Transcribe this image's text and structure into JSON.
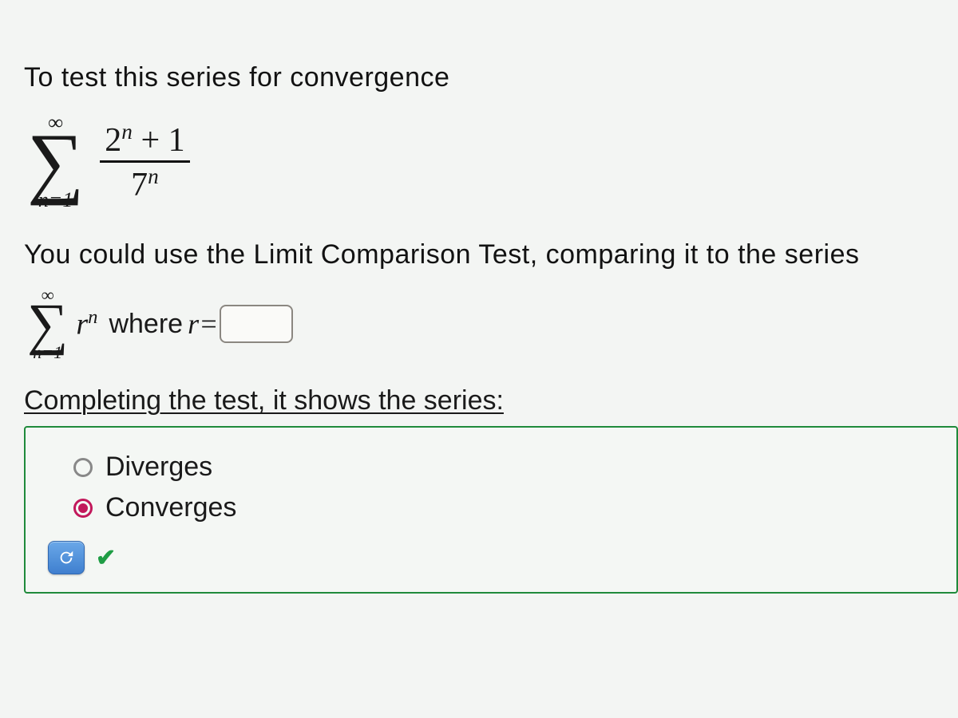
{
  "question": {
    "intro": "To test this series for convergence",
    "series": {
      "upper": "∞",
      "lower": "n=1",
      "numerator_html": "2<sup class='sm'>n</sup> + 1",
      "denominator_html": "7<sup class='sm'>n</sup>"
    },
    "comparison_text": "You could use the Limit Comparison Test, comparing it to the series",
    "compare_series": {
      "upper": "∞",
      "lower": "n=1",
      "term_html": "r<sup class='sm'>n</sup>"
    },
    "where_label": "where",
    "r_equals": "r=",
    "r_input_value": "",
    "completing_text": "Completing the test, it shows the series:",
    "options": {
      "diverges": "Diverges",
      "converges": "Converges"
    },
    "selected": "converges"
  }
}
